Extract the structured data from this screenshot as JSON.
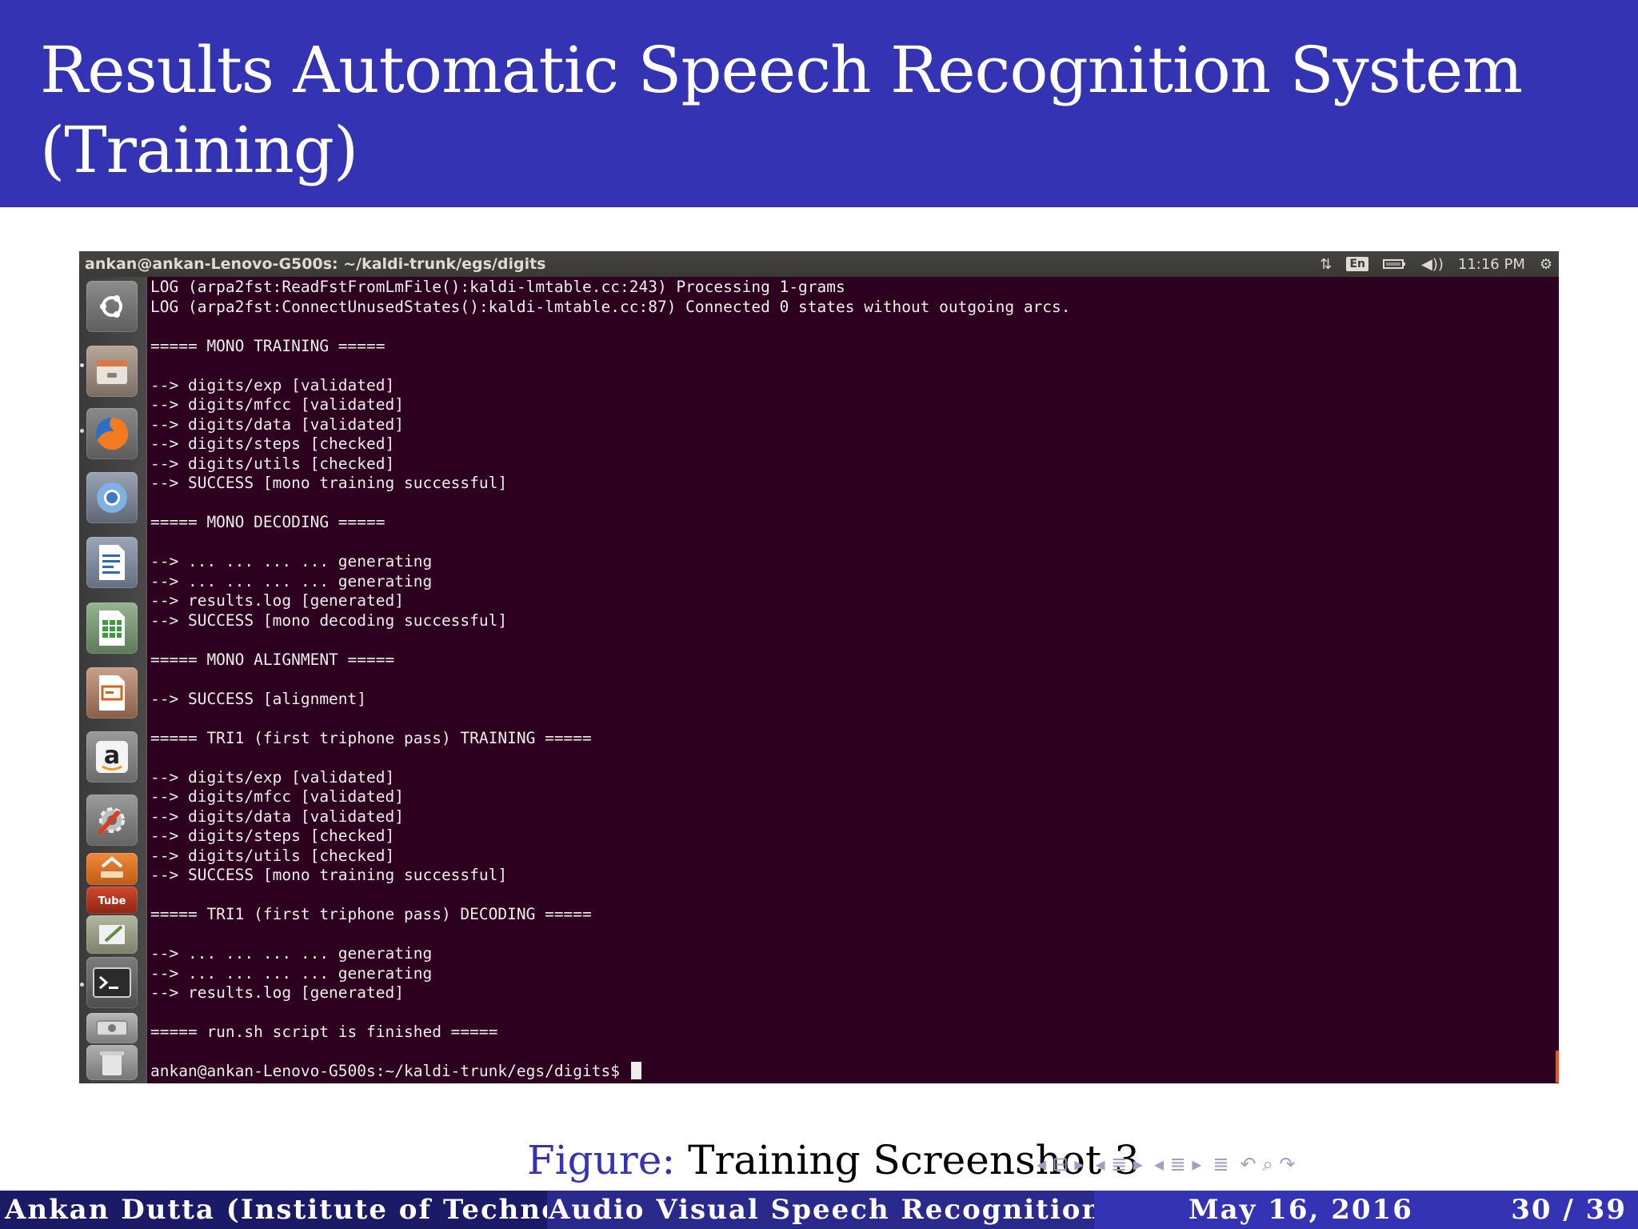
{
  "slide": {
    "title": "Results Automatic Speech Recognition System (Training)",
    "caption_label": "Figure:",
    "caption_text": " Training Screenshot 3"
  },
  "screenshot": {
    "window_title": "ankan@ankan-Lenovo-G500s: ~/kaldi-trunk/egs/digits",
    "tray": {
      "network_icon": "network-arrows-icon",
      "language": "En",
      "battery_icon": "battery-icon",
      "volume_icon": "volume-icon",
      "clock": "11:16 PM",
      "settings_icon": "gear-icon"
    },
    "launcher_icons": [
      "ubuntu-dash-icon",
      "files-icon",
      "firefox-icon",
      "chromium-icon",
      "writer-icon",
      "calc-icon",
      "impress-icon",
      "amazon-icon",
      "system-settings-icon",
      "software-center-icon",
      "youtube-icon",
      "text-editor-icon",
      "terminal-icon",
      "disk-drive-icon",
      "trash-icon"
    ],
    "terminal_lines": [
      "LOG (arpa2fst:ReadFstFromLmFile():kaldi-lmtable.cc:243) Processing 1-grams",
      "LOG (arpa2fst:ConnectUnusedStates():kaldi-lmtable.cc:87) Connected 0 states without outgoing arcs.",
      "",
      "===== MONO TRAINING =====",
      "",
      "--> digits/exp [validated]",
      "--> digits/mfcc [validated]",
      "--> digits/data [validated]",
      "--> digits/steps [checked]",
      "--> digits/utils [checked]",
      "--> SUCCESS [mono training successful]",
      "",
      "===== MONO DECODING =====",
      "",
      "--> ... ... ... ... generating",
      "--> ... ... ... ... generating",
      "--> results.log [generated]",
      "--> SUCCESS [mono decoding successful]",
      "",
      "===== MONO ALIGNMENT =====",
      "",
      "--> SUCCESS [alignment]",
      "",
      "===== TRI1 (first triphone pass) TRAINING =====",
      "",
      "--> digits/exp [validated]",
      "--> digits/mfcc [validated]",
      "--> digits/data [validated]",
      "--> digits/steps [checked]",
      "--> digits/utils [checked]",
      "--> SUCCESS [mono training successful]",
      "",
      "===== TRI1 (first triphone pass) DECODING =====",
      "",
      "--> ... ... ... ... generating",
      "--> ... ... ... ... generating",
      "--> results.log [generated]",
      "",
      "===== run.sh script is finished =====",
      ""
    ],
    "prompt": "ankan@ankan-Lenovo-G500s:~/kaldi-trunk/egs/digits$ "
  },
  "nav": {
    "icons": [
      "nav-frame-icon",
      "nav-section-icon",
      "nav-subsection-icon",
      "nav-align-icon",
      "nav-search-icon"
    ]
  },
  "footer": {
    "author": "Ankan Dutta (Institute of Technology, Nirma University)",
    "talk_title": "Audio Visual Speech Recognition",
    "date": "May 16, 2016",
    "page": "30 / 39"
  },
  "colors": {
    "header_bg": "#3333b3",
    "terminal_bg": "#2c001e",
    "footer_left": "#1a1a66",
    "footer_mid": "#2a2a8c",
    "footer_right": "#3333b3"
  }
}
